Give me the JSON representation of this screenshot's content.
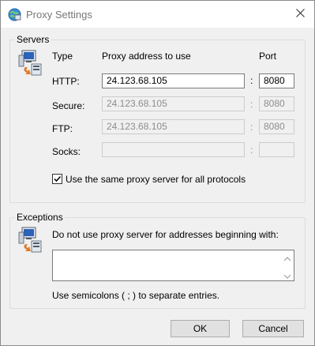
{
  "window": {
    "title": "Proxy Settings"
  },
  "servers": {
    "group_label": "Servers",
    "col_type": "Type",
    "col_address": "Proxy address to use",
    "col_port": "Port",
    "rows": [
      {
        "type": "HTTP:",
        "address": "24.123.68.105",
        "port": "8080",
        "enabled": true
      },
      {
        "type": "Secure:",
        "address": "24.123.68.105",
        "port": "8080",
        "enabled": false
      },
      {
        "type": "FTP:",
        "address": "24.123.68.105",
        "port": "8080",
        "enabled": false
      },
      {
        "type": "Socks:",
        "address": "",
        "port": "",
        "enabled": false
      }
    ],
    "colon": ":",
    "same_proxy_label": "Use the same proxy server for all protocols",
    "same_proxy_checked": true
  },
  "exceptions": {
    "group_label": "Exceptions",
    "description": "Do not use proxy server for addresses beginning with:",
    "value": "",
    "hint": "Use semicolons ( ; ) to separate entries."
  },
  "buttons": {
    "ok": "OK",
    "cancel": "Cancel"
  },
  "icons": {
    "title": "globe-network-icon",
    "servers": "network-computer-icon",
    "exceptions": "network-computer-icon",
    "close": "close-icon",
    "check": "check-icon"
  },
  "colors": {
    "field_border": "#7a7a7a",
    "disabled_text": "#8d8d8d",
    "button_bg": "#e1e1e1"
  }
}
